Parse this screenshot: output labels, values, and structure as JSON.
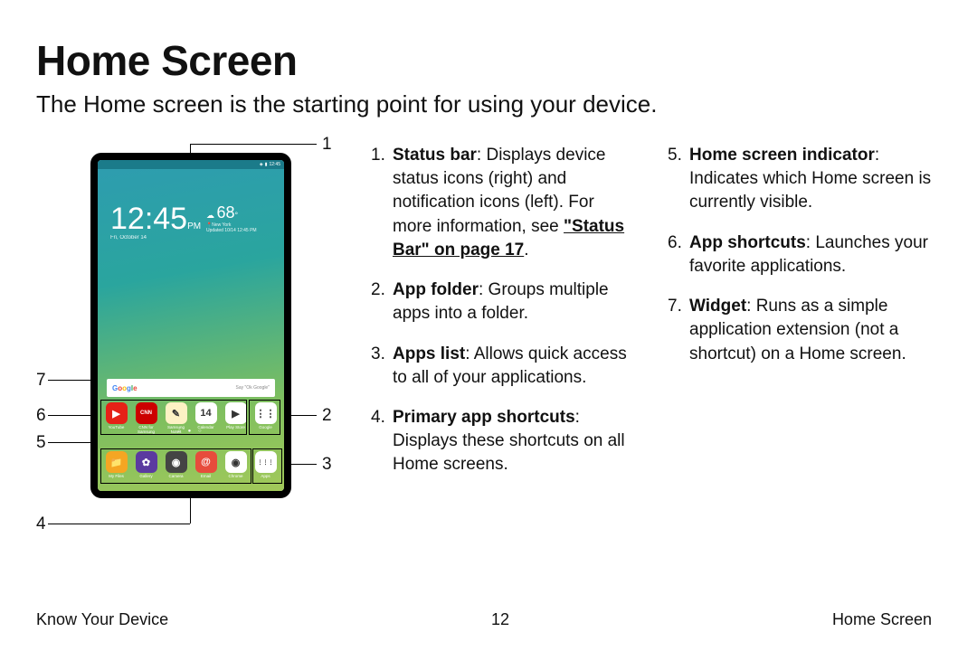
{
  "title": "Home Screen",
  "subtitle": "The Home screen is the starting point for using your device.",
  "device": {
    "time": "12:45",
    "ampm": "PM",
    "date": "Fri, October 14",
    "temp": "68",
    "temp_unit": "°",
    "city": "New York",
    "updated": "Updated 10/14 12:45 PM",
    "search_logo": "Google",
    "search_hint": "Say \"Ok Google\"",
    "row1": [
      {
        "name": "YouTube",
        "bg": "#e62117",
        "fg": "▶"
      },
      {
        "name": "CNN for Samsung",
        "bg": "#cc0000",
        "fg": "CNN"
      },
      {
        "name": "Samsung Notes",
        "bg": "#fdf2c4",
        "fg": "✎"
      },
      {
        "name": "Calendar",
        "bg": "#ffffff",
        "fg": "14"
      },
      {
        "name": "Play Store",
        "bg": "#ffffff",
        "fg": "▶"
      },
      {
        "name": "Google",
        "bg": "#ffffff",
        "fg": "⋮⋮"
      }
    ],
    "row2": [
      {
        "name": "My Files",
        "bg": "#f5a623",
        "fg": "📁"
      },
      {
        "name": "Gallery",
        "bg": "#5b3aa0",
        "fg": "✿"
      },
      {
        "name": "Camera",
        "bg": "#444",
        "fg": "◉"
      },
      {
        "name": "Email",
        "bg": "#e74c3c",
        "fg": "@"
      },
      {
        "name": "Chrome",
        "bg": "#fff",
        "fg": "◉"
      },
      {
        "name": "Apps",
        "bg": "#fff",
        "fg": "⋮⋮⋮"
      }
    ]
  },
  "callouts": {
    "c1": "1",
    "c2": "2",
    "c3": "3",
    "c4": "4",
    "c5": "5",
    "c6": "6",
    "c7": "7"
  },
  "items_a": [
    {
      "bold": "Status bar",
      "rest": ": Displays device status icons (right) and notification icons (left). For more information, see ",
      "link": "\"Status Bar\" on page 17",
      "tail": "."
    },
    {
      "bold": "App folder",
      "rest": ": Groups multiple apps into a folder."
    },
    {
      "bold": "Apps list",
      "rest": ": Allows quick access to all of your applications."
    },
    {
      "bold": "Primary app shortcuts",
      "rest": ": Displays these shortcuts on all Home screens."
    }
  ],
  "items_b": [
    {
      "bold": "Home screen indicator",
      "rest": ": Indicates which Home screen is currently visible."
    },
    {
      "bold": "App shortcuts",
      "rest": ": Launches your favorite applications."
    },
    {
      "bold": "Widget",
      "rest": ": Runs as a simple application extension (not a shortcut) on a Home screen."
    }
  ],
  "footer": {
    "left": "Know Your Device",
    "center": "12",
    "right": "Home Screen"
  }
}
